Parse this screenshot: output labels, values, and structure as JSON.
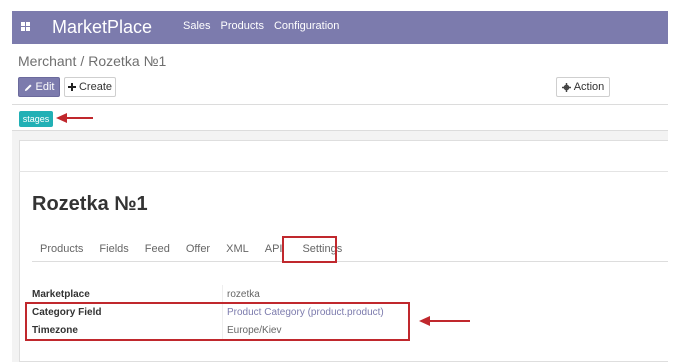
{
  "navbar": {
    "brand": "MarketPlace",
    "menu": [
      "Sales",
      "Products",
      "Configuration"
    ]
  },
  "breadcrumb": {
    "parent": "Merchant",
    "separator": "/",
    "current": "Rozetka №1"
  },
  "buttons": {
    "edit": "Edit",
    "create": "Create",
    "action": "Action"
  },
  "status": {
    "stage": "stages"
  },
  "record": {
    "title": "Rozetka №1"
  },
  "tabs": [
    "Products",
    "Fields",
    "Feed",
    "Offer",
    "XML",
    "API",
    "Settings"
  ],
  "fields": [
    {
      "label": "Marketplace",
      "value": "rozetka"
    },
    {
      "label": "Category Field",
      "value": "Product Category (product.product)"
    },
    {
      "label": "Timezone",
      "value": "Europe/Kiev"
    }
  ],
  "colors": {
    "navbar": "#7c7bad",
    "stage": "#21b0b5",
    "highlight": "#c0282d"
  }
}
